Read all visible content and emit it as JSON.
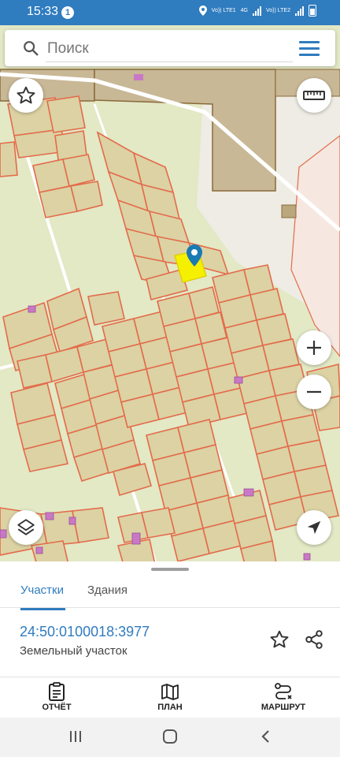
{
  "status_bar": {
    "time": "15:33",
    "notification_count": "1",
    "network_1": "Vo)) LTE1",
    "network_type": "4G",
    "network_2": "Vo)) LTE2"
  },
  "search": {
    "placeholder": "Поиск"
  },
  "map": {
    "selected_parcel_color": "#f5f000",
    "parcel_fill": "#dcd2a4",
    "parcel_border": "#e36b4a",
    "marker_color": "#1a7ab3"
  },
  "sheet": {
    "tabs": [
      {
        "label": "Участки",
        "active": true
      },
      {
        "label": "Здания",
        "active": false
      }
    ],
    "parcel": {
      "cadastral_number": "24:50:0100018:3977",
      "type": "Земельный участок"
    }
  },
  "bottom_nav": [
    {
      "label": "ОТЧЁТ",
      "icon": "report-icon"
    },
    {
      "label": "ПЛАН",
      "icon": "map-plan-icon"
    },
    {
      "label": "МАРШРУТ",
      "icon": "route-icon"
    }
  ],
  "accent_color": "#2f7cbf"
}
